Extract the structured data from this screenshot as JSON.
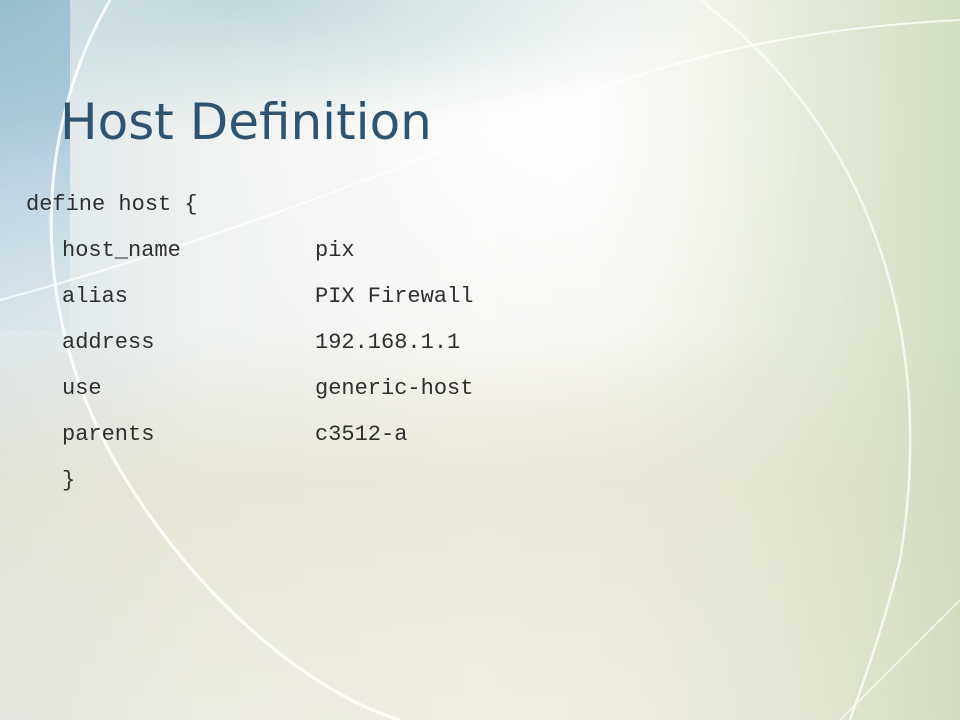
{
  "slide": {
    "title": "Host Definition",
    "code": {
      "opening": "define host {",
      "fields": [
        {
          "key": "host_name",
          "value": "pix"
        },
        {
          "key": "alias",
          "value": "PIX Firewall"
        },
        {
          "key": "address",
          "value": "192.168.1.1"
        },
        {
          "key": "use",
          "value": "generic-host"
        },
        {
          "key": "parents",
          "value": "c3512-a"
        }
      ],
      "closing": "}"
    }
  },
  "theme": {
    "title_color": "#2e5470",
    "text_color": "#2f2f2f",
    "accent_blue": "#7fb3cf",
    "accent_green": "#c9d8b4"
  }
}
